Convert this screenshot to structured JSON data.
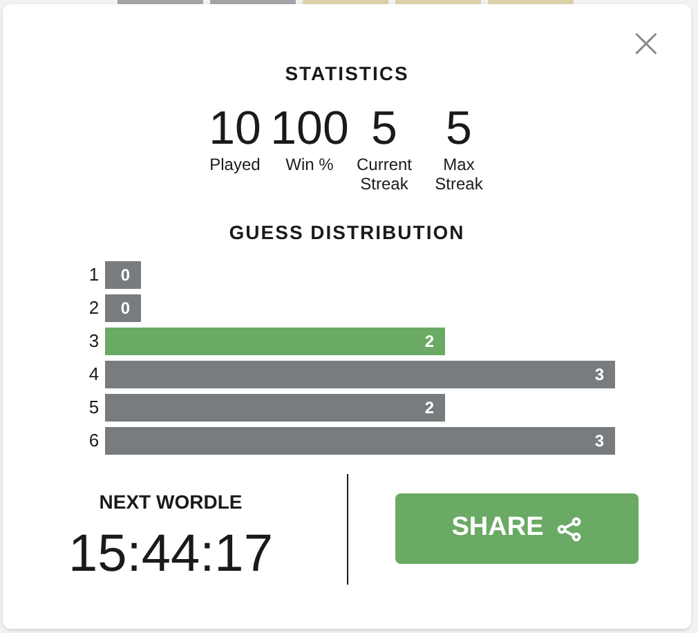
{
  "board_tiles": [
    {
      "color": "#a3a5a6"
    },
    {
      "color": "#a3a5a6"
    },
    {
      "color": "#dcd2a8"
    },
    {
      "color": "#dcd2a8"
    },
    {
      "color": "#dcd2a8"
    }
  ],
  "close": "×",
  "statistics": {
    "title": "STATISTICS",
    "items": [
      {
        "value": "10",
        "label": "Played"
      },
      {
        "value": "100",
        "label": "Win %"
      },
      {
        "value": "5",
        "label": "Current Streak"
      },
      {
        "value": "5",
        "label": "Max Streak"
      }
    ]
  },
  "guess_distribution": {
    "title": "GUESS DISTRIBUTION",
    "rows": [
      {
        "guess": "1",
        "count": "0",
        "current": false
      },
      {
        "guess": "2",
        "count": "0",
        "current": false
      },
      {
        "guess": "3",
        "count": "2",
        "current": true
      },
      {
        "guess": "4",
        "count": "3",
        "current": false
      },
      {
        "guess": "5",
        "count": "2",
        "current": false
      },
      {
        "guess": "6",
        "count": "3",
        "current": false
      }
    ]
  },
  "next_wordle": {
    "title": "NEXT WORDLE",
    "countdown": "15:44:17"
  },
  "share_button": "SHARE"
}
